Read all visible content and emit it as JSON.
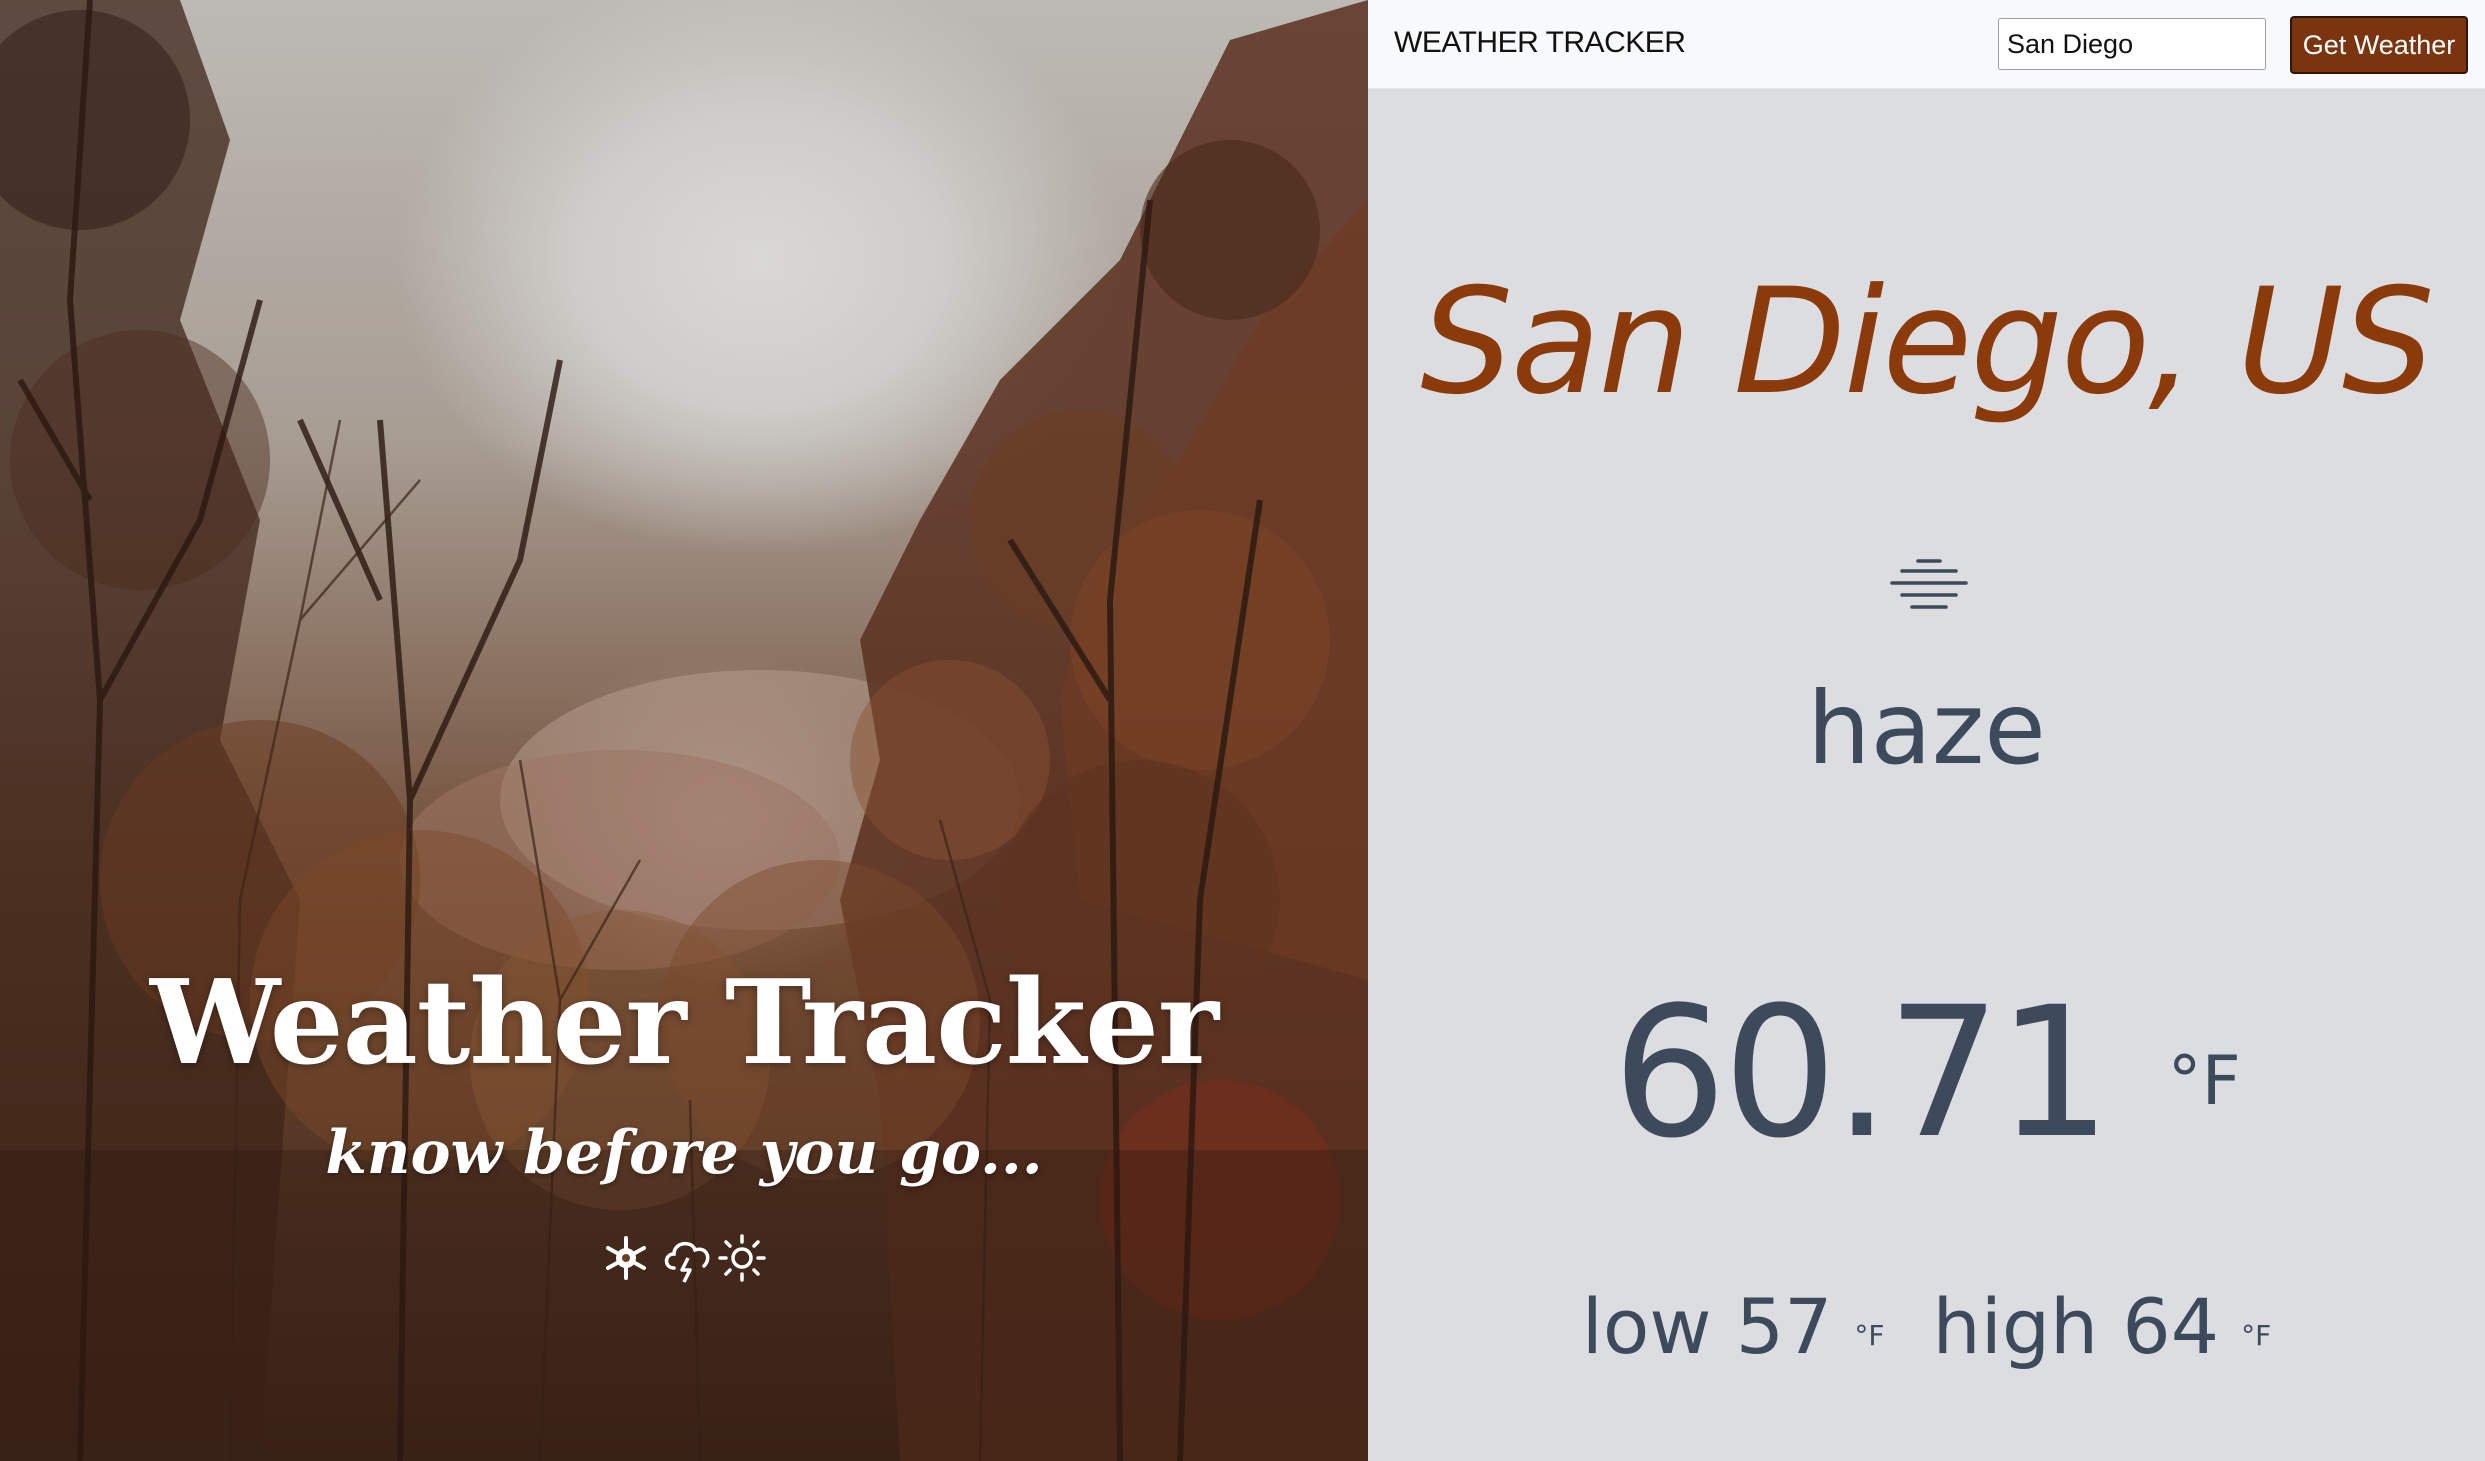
{
  "hero": {
    "title": "Weather Tracker",
    "tagline": "know before you go...",
    "icons": [
      "snowflake-icon",
      "storm-cloud-icon",
      "sun-icon"
    ]
  },
  "navbar": {
    "brand": "WEATHER TRACKER",
    "search_value": "San Diego",
    "button_label": "Get Weather"
  },
  "weather": {
    "location": "San Diego, US",
    "condition_icon": "haze-icon",
    "condition": "haze",
    "temperature": "60.71",
    "unit": "°F",
    "low_label": "low 57",
    "low_unit": "°F",
    "high_label": "high 64",
    "high_unit": "°F"
  },
  "colors": {
    "accent": "#7a3510",
    "location_text": "#8b3a0b",
    "body_text": "#3d4a5c",
    "panel_bg": "#dcdde0",
    "navbar_bg": "#f8f9fa"
  }
}
